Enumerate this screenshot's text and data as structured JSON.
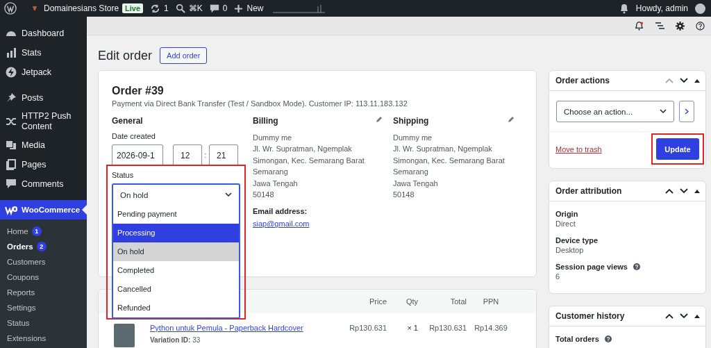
{
  "admin_bar": {
    "site_name": "Domainesians Store",
    "live_badge": "Live",
    "updates_count": "1",
    "search_shortcut": "⌘K",
    "comments_count": "0",
    "new_label": "New",
    "greeting": "Howdy, admin"
  },
  "sidebar": {
    "groups": [
      [
        {
          "label": "Dashboard",
          "selected": false
        },
        {
          "label": "Stats",
          "selected": false
        },
        {
          "label": "Jetpack",
          "selected": false
        }
      ],
      [
        {
          "label": "Posts",
          "selected": false
        },
        {
          "label": "HTTP2 Push Content",
          "selected": false
        },
        {
          "label": "Media",
          "selected": false
        },
        {
          "label": "Pages",
          "selected": false
        },
        {
          "label": "Comments",
          "selected": false
        }
      ],
      [
        {
          "label": "WooCommerce",
          "selected": true,
          "children": [
            {
              "label": "Home",
              "selected": false,
              "badge": "1"
            },
            {
              "label": "Orders",
              "selected": true,
              "badge": "2"
            },
            {
              "label": "Customers",
              "selected": false
            },
            {
              "label": "Coupons",
              "selected": false
            },
            {
              "label": "Reports",
              "selected": false
            },
            {
              "label": "Settings",
              "selected": false
            },
            {
              "label": "Status",
              "selected": false
            },
            {
              "label": "Extensions",
              "selected": false
            }
          ]
        }
      ]
    ]
  },
  "page": {
    "title": "Edit order",
    "add_button": "Add order"
  },
  "order": {
    "title": "Order #39",
    "payment_info": "Payment via Direct Bank Transfer (Test / Sandbox Mode). Customer IP: 113.11.183.132",
    "general": {
      "heading": "General",
      "date_label": "Date created",
      "date": "2026-09-1",
      "hour": "12",
      "separator": ":",
      "minute": "21",
      "status_label": "Status",
      "status_value": "On hold",
      "status_open": true,
      "highlighted": true,
      "options": [
        {
          "label": "Pending payment",
          "selected": false,
          "hovered": false
        },
        {
          "label": "Processing",
          "selected": false,
          "hovered": true
        },
        {
          "label": "On hold",
          "selected": true,
          "hovered": false
        },
        {
          "label": "Completed",
          "selected": false,
          "hovered": false
        },
        {
          "label": "Cancelled",
          "selected": false,
          "hovered": false
        },
        {
          "label": "Refunded",
          "selected": false,
          "hovered": false
        }
      ]
    },
    "billing": {
      "heading": "Billing",
      "lines": [
        "Dummy me",
        "Jl. Wr. Supratman, Ngemplak",
        "Simongan, Kec. Semarang Barat",
        "Semarang",
        "Jawa Tengah",
        "50148"
      ],
      "email_label": "Email address:",
      "email": "siap@gmail.com"
    },
    "shipping": {
      "heading": "Shipping",
      "lines": [
        "Dummy me",
        "Jl. Wr. Supratman, Ngemplak",
        "Simongan, Kec. Semarang Barat",
        "Semarang",
        "Jawa Tengah",
        "50148"
      ]
    }
  },
  "items": {
    "columns": [
      "Price",
      "Qty",
      "Total",
      "PPN"
    ],
    "rows": [
      {
        "name": "Python untuk Pemula - Paperback Hardcover",
        "meta": "**Variation ID:** 33",
        "price": "Rp130.631",
        "qty": "× 1",
        "total": "Rp130.631",
        "tax": "Rp14.369"
      }
    ]
  },
  "order_actions": {
    "title": "Order actions",
    "can_move_up": false,
    "select_placeholder": "Choose an action...",
    "trash": "Move to trash",
    "update": "Update",
    "update_highlighted": true
  },
  "attribution": {
    "title": "Order attribution",
    "can_move_up": true,
    "fields": [
      {
        "label": "Origin",
        "value": "Direct",
        "help": false
      },
      {
        "label": "Device type",
        "value": "Desktop",
        "help": false
      },
      {
        "label": "Session page views",
        "value": "6",
        "help": true
      }
    ]
  },
  "history": {
    "title": "Customer history",
    "can_move_up": true,
    "fields": [
      {
        "label": "Total orders",
        "help": true
      }
    ]
  }
}
